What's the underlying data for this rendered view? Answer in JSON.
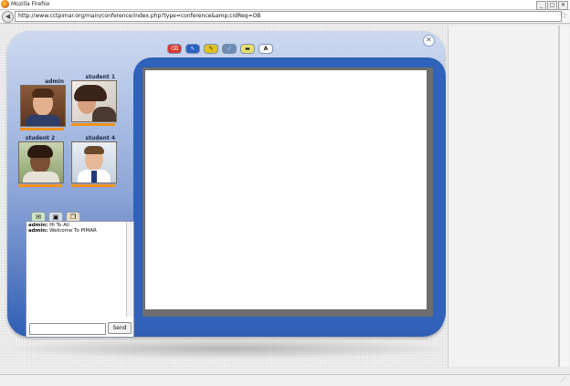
{
  "window": {
    "title": "Mozilla Firefox",
    "controls": [
      "_",
      "□",
      "✕"
    ]
  },
  "navigation": {
    "url": "http://www.cctpimar.org/main/conference/index.php?type=conference&amp;cidReq=OB"
  },
  "conference": {
    "toolbar": [
      {
        "icon": "eraser-icon",
        "glyph": "⌫",
        "color": "#d9352b"
      },
      {
        "icon": "pointer-icon",
        "glyph": "↖",
        "color": "#2a62c4"
      },
      {
        "icon": "pencil-icon",
        "glyph": "✎",
        "color": "#e0c21d"
      },
      {
        "icon": "brush-icon",
        "glyph": "⟋",
        "color": "#6d8baf"
      },
      {
        "icon": "highlighter-icon",
        "glyph": "▬",
        "color": "#e8e26a"
      },
      {
        "icon": "text-tool-icon",
        "glyph": "A",
        "color": "#ffffff"
      }
    ],
    "participants": [
      {
        "name": "admin"
      },
      {
        "name": "student 1"
      },
      {
        "name": "student 2"
      },
      {
        "name": "student 4"
      }
    ],
    "chat": {
      "tabs": [
        "chat-tab-icon",
        "video-tab-icon",
        "files-tab-icon"
      ],
      "messages": [
        {
          "author": "admin:",
          "text": " Hi To All"
        },
        {
          "author": "admin:",
          "text": " Welcome To PIMAR"
        }
      ],
      "input_value": "",
      "send_label": "Send"
    }
  }
}
